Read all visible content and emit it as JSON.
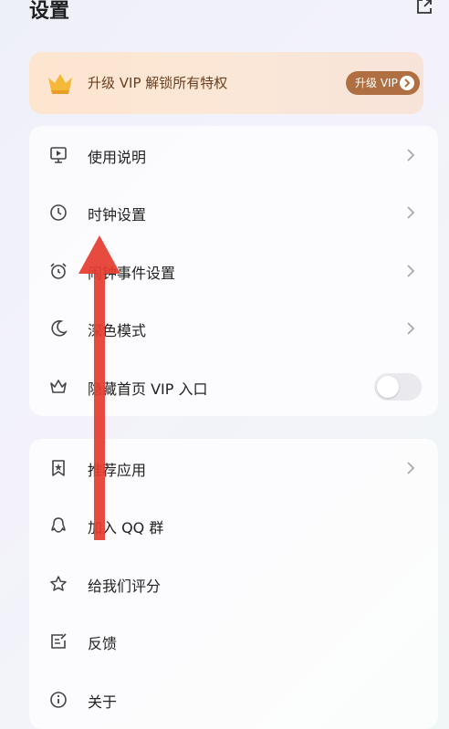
{
  "header": {
    "title": "设置",
    "share_icon": "share-icon"
  },
  "vip_banner": {
    "text": "升级 VIP 解锁所有特权",
    "button_label": "升级 VIP",
    "icon": "crown-icon",
    "accent": "#b06f42"
  },
  "group1": [
    {
      "label": "使用说明",
      "icon": "tutorial-icon"
    },
    {
      "label": "时钟设置",
      "icon": "clock-icon"
    },
    {
      "label": "闹钟事件设置",
      "icon": "alarm-icon"
    },
    {
      "label": "深色模式",
      "icon": "moon-icon"
    },
    {
      "label": "隐藏首页 VIP 入口",
      "icon": "crown-outline-icon",
      "toggle_on": false
    }
  ],
  "group2": [
    {
      "label": "推荐应用",
      "icon": "bookmark-star-icon"
    },
    {
      "label": "加入 QQ 群",
      "icon": "qq-icon"
    },
    {
      "label": "给我们评分",
      "icon": "star-icon"
    },
    {
      "label": "反馈",
      "icon": "feedback-icon"
    },
    {
      "label": "关于",
      "icon": "info-icon"
    }
  ],
  "overlay": {
    "annotation": "red-arrow-up",
    "color": "#e53b2e"
  }
}
